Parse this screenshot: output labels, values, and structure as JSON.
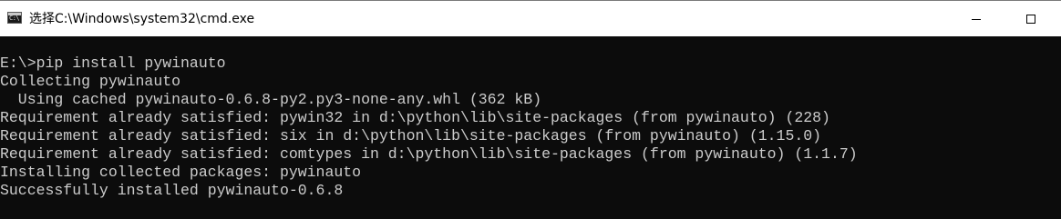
{
  "window": {
    "title": "选择C:\\Windows\\system32\\cmd.exe",
    "icon": "cmd-icon",
    "icon_text": "C:\\"
  },
  "controls": {
    "minimize_icon": "minimize-icon",
    "maximize_icon": "maximize-icon"
  },
  "console": {
    "lines": [
      "",
      "E:\\>pip install pywinauto",
      "Collecting pywinauto",
      "  Using cached pywinauto-0.6.8-py2.py3-none-any.whl (362 kB)",
      "Requirement already satisfied: pywin32 in d:\\python\\lib\\site-packages (from pywinauto) (228)",
      "Requirement already satisfied: six in d:\\python\\lib\\site-packages (from pywinauto) (1.15.0)",
      "Requirement already satisfied: comtypes in d:\\python\\lib\\site-packages (from pywinauto) (1.1.7)",
      "Installing collected packages: pywinauto",
      "Successfully installed pywinauto-0.6.8"
    ]
  },
  "colors": {
    "console_bg": "#0c0c0c",
    "console_text": "#cccccc",
    "titlebar_bg": "#ffffff"
  }
}
